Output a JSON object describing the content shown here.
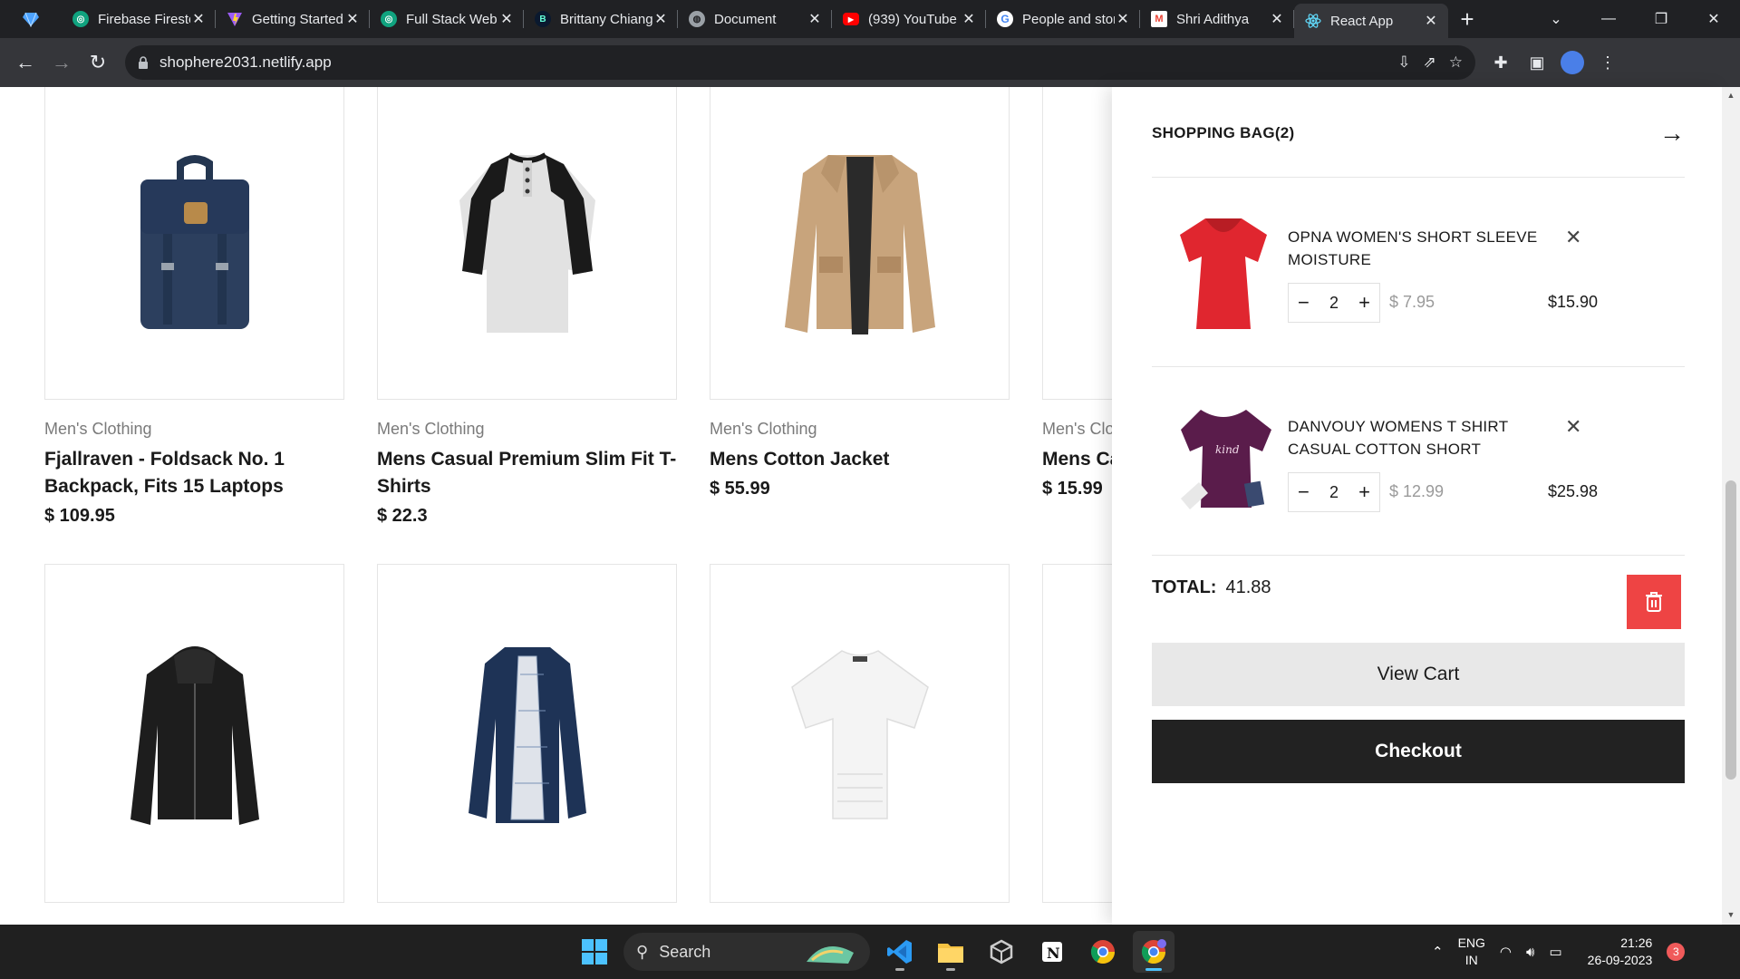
{
  "browser": {
    "tabs": [
      {
        "title": "Firebase Firestore",
        "icon": "chatgpt-icon",
        "color": "#10a37f"
      },
      {
        "title": "Getting Started",
        "icon": "vite-icon",
        "color": "#9b5cf6"
      },
      {
        "title": "Full Stack Web",
        "icon": "chatgpt-icon",
        "color": "#10a37f"
      },
      {
        "title": "Brittany Chiang",
        "icon": "b-icon",
        "color": "#0a192f"
      },
      {
        "title": "Document",
        "icon": "globe-icon",
        "color": "#9aa0a6"
      },
      {
        "title": "(939) YouTube",
        "icon": "youtube-icon",
        "color": "#ff0000"
      },
      {
        "title": "People and stories",
        "icon": "google-icon",
        "color": "#ffffff"
      },
      {
        "title": "Shri Adithya",
        "icon": "gmail-icon",
        "color": "#ffffff"
      },
      {
        "title": "React App",
        "icon": "react-icon",
        "color": "#61dafb"
      }
    ],
    "active_tab": 8,
    "url": "shophere2031.netlify.app"
  },
  "products": [
    {
      "category": "Men's Clothing",
      "name": "Fjallraven - Foldsack No. 1 Backpack, Fits 15 Laptops",
      "price": "$ 109.95",
      "image": "backpack"
    },
    {
      "category": "Men's Clothing",
      "name": "Mens Casual Premium Slim Fit T-Shirts",
      "price": "$ 22.3",
      "image": "raglan-shirt"
    },
    {
      "category": "Men's Clothing",
      "name": "Mens Cotton Jacket",
      "price": "$ 55.99",
      "image": "cotton-jacket"
    },
    {
      "category": "Men's Clothing",
      "name": "Mens Casual Slim Fit",
      "price": "$ 15.99",
      "image": "hidden"
    },
    {
      "image": "leather-jacket"
    },
    {
      "image": "rain-jacket"
    },
    {
      "image": "white-tee"
    },
    {
      "image": "hidden"
    }
  ],
  "cart": {
    "title": "SHOPPING BAG(2)",
    "items": [
      {
        "name": "OPNA WOMEN'S SHORT SLEEVE MOISTURE",
        "qty": "2",
        "unit_price": "$ 7.95",
        "line_total": "$15.90",
        "image": "red-shirt"
      },
      {
        "name": "DANVOUY WOMENS T SHIRT CASUAL COTTON SHORT",
        "qty": "2",
        "unit_price": "$ 12.99",
        "line_total": "$25.98",
        "image": "purple-shirt"
      }
    ],
    "total_label": "TOTAL:",
    "total_value": "41.88",
    "view_cart_label": "View Cart",
    "checkout_label": "Checkout",
    "trash_color": "#ee4444"
  },
  "taskbar": {
    "search_placeholder": "Search",
    "lang_line1": "ENG",
    "lang_line2": "IN",
    "time": "21:26",
    "date": "26-09-2023",
    "notifications": "3"
  }
}
